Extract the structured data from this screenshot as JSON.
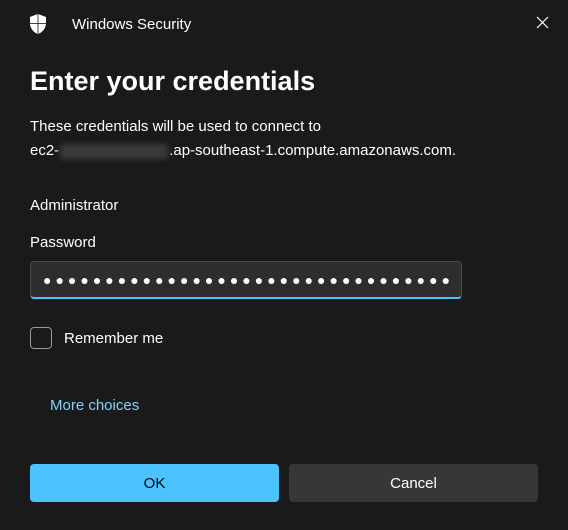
{
  "titlebar": {
    "title": "Windows Security"
  },
  "heading": "Enter your credentials",
  "description": {
    "line1": "These credentials will be used to connect to",
    "host_prefix": "ec2-",
    "host_suffix": ".ap-southeast-1.compute.amazonaws.com."
  },
  "username": "Administrator",
  "password": {
    "label": "Password",
    "value": "●●●●●●●●●●●●●●●●●●●●●●●●●●●●●●●●●"
  },
  "remember": {
    "label": "Remember me",
    "checked": false
  },
  "more_choices": "More choices",
  "buttons": {
    "ok": "OK",
    "cancel": "Cancel"
  },
  "colors": {
    "accent": "#4cc2ff",
    "background": "#1a1a1a",
    "link": "#81d4fa"
  }
}
